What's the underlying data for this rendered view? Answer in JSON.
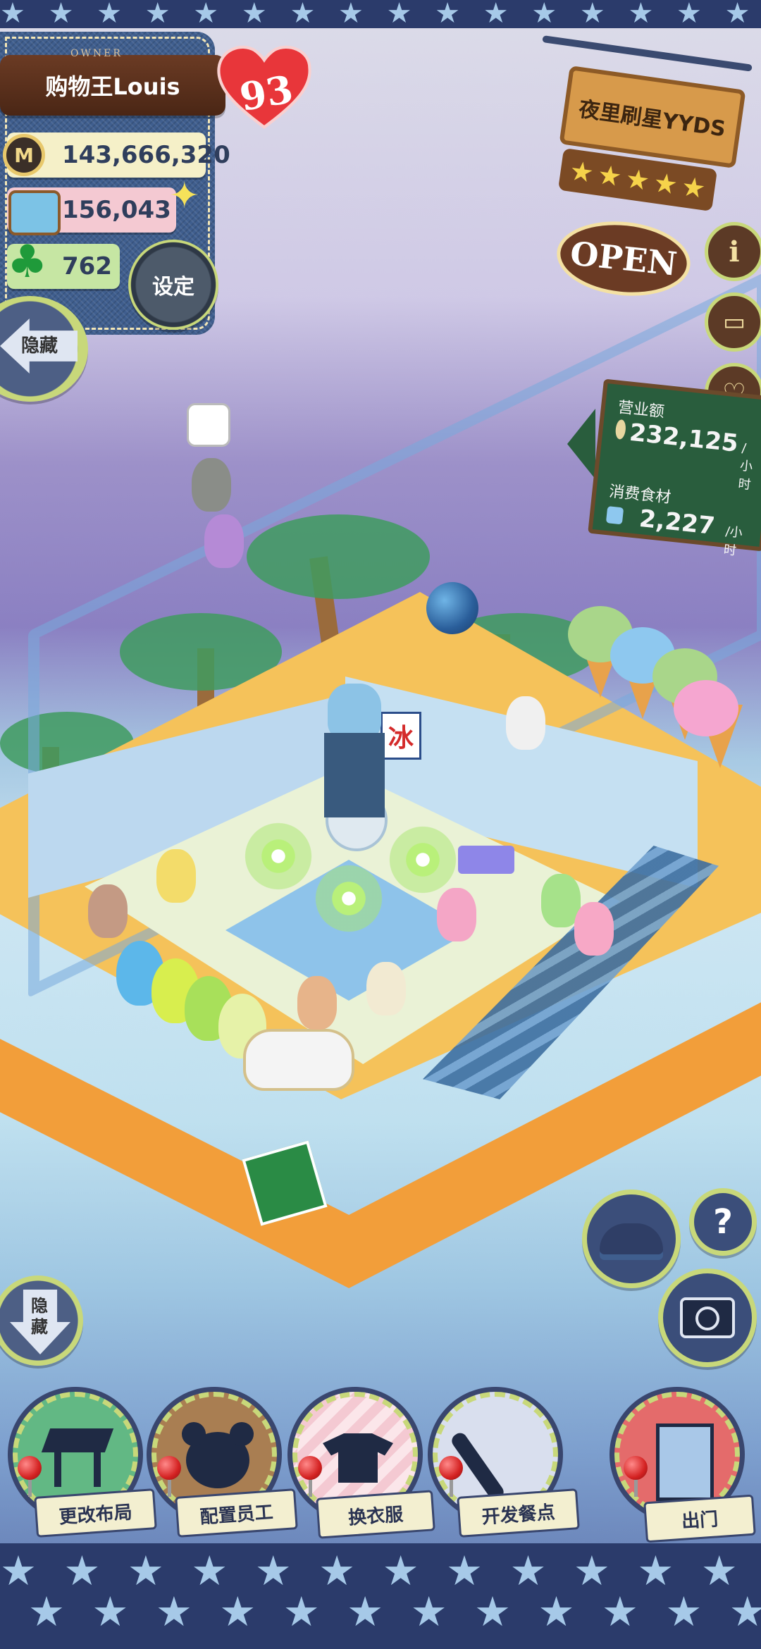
{
  "owner": {
    "tag": "OWNER",
    "name": "购物王Louis",
    "level": "93"
  },
  "stats": {
    "money": "143,666,320",
    "money_icon": "M",
    "ingredients": "156,043",
    "clovers": "762"
  },
  "buttons": {
    "settings": "设定",
    "hide_top": "隐藏",
    "hide_bottom": "隐藏"
  },
  "shop": {
    "name": "夜里刷星YYDS",
    "rating": 5,
    "status": "OPEN"
  },
  "side_buttons": {
    "info": "i"
  },
  "revenue": {
    "sales_label": "营业额",
    "sales_value": "232,125",
    "sales_unit": "/小时",
    "consumption_label": "消费食材",
    "consumption_value": "2,227",
    "consumption_unit": "/小时"
  },
  "scene": {
    "shop_banner_char": "冰"
  },
  "help": {
    "question": "?"
  },
  "toolbar": {
    "layout": "更改布局",
    "staff": "配置员工",
    "clothes": "换衣服",
    "menu": "开发餐点",
    "exit": "出门"
  },
  "colors": {
    "accent_green": "#c8d87a",
    "denim": "#3f5e8e",
    "wood": "#6b3b24",
    "heart_red": "#e8363a",
    "board_green": "#295d3d"
  }
}
